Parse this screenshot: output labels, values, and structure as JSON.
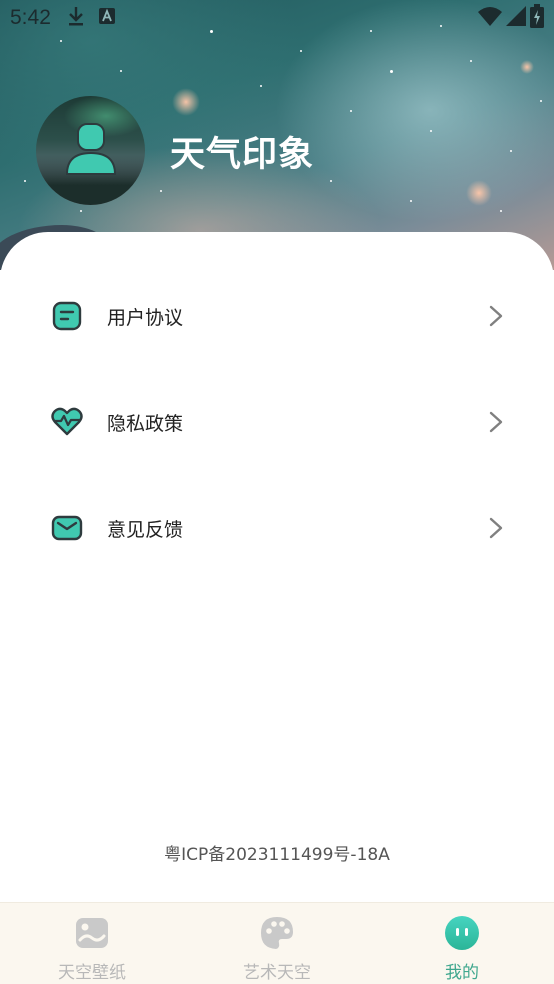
{
  "status_bar": {
    "time": "5:42",
    "icons": [
      "download-icon",
      "keyboard-a-icon",
      "wifi-icon",
      "signal-icon",
      "battery-charging-icon"
    ]
  },
  "profile": {
    "app_name": "天气印象",
    "avatar_icon": "user-person-icon"
  },
  "menu": {
    "items": [
      {
        "label": "用户协议",
        "icon": "document-icon"
      },
      {
        "label": "隐私政策",
        "icon": "heart-pulse-icon"
      },
      {
        "label": "意见反馈",
        "icon": "mail-icon"
      }
    ]
  },
  "footer": {
    "icp": "粤ICP备2023111499号-18A"
  },
  "bottom_nav": {
    "items": [
      {
        "label": "天空壁纸",
        "icon": "image-icon",
        "active": false
      },
      {
        "label": "艺术天空",
        "icon": "palette-icon",
        "active": false
      },
      {
        "label": "我的",
        "icon": "face-icon",
        "active": true
      }
    ]
  },
  "colors": {
    "accent": "#40c9b0",
    "accent_dark": "#2e3b3e",
    "active_nav": "#3fa78e",
    "inactive_nav": "#b8b8b8"
  }
}
